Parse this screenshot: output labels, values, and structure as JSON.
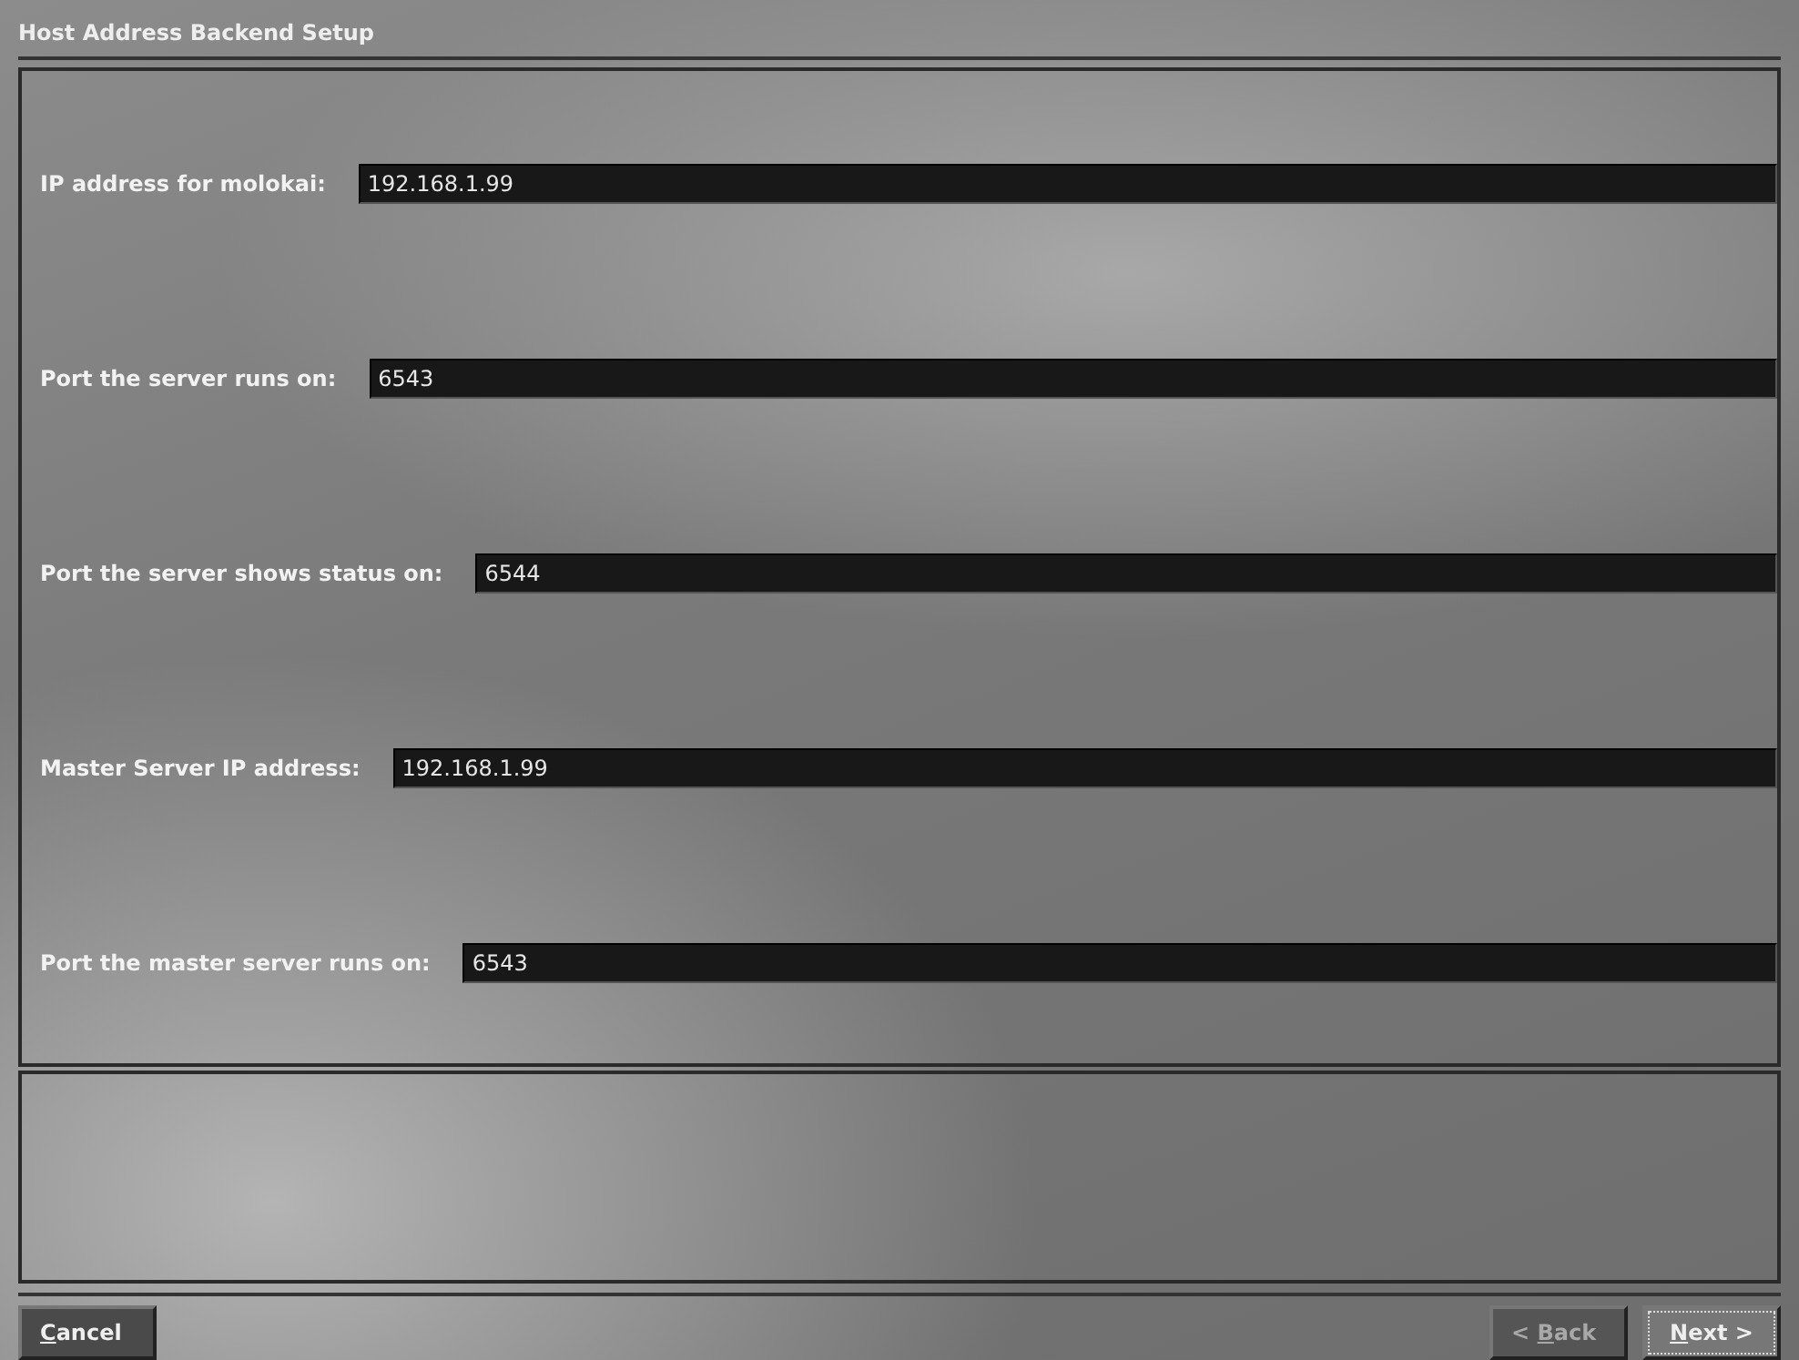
{
  "window": {
    "title": "Host Address Backend Setup"
  },
  "fields": [
    {
      "label": "IP address for molokai:",
      "value": "192.168.1.99"
    },
    {
      "label": "Port the server runs on:",
      "value": "6543"
    },
    {
      "label": "Port the server shows status on:",
      "value": "6544"
    },
    {
      "label": "Master Server IP address:",
      "value": "192.168.1.99"
    },
    {
      "label": "Port the master server runs on:",
      "value": "6543"
    }
  ],
  "buttons": [
    {
      "accesskey": "C",
      "after": "ancel",
      "disabled": false,
      "focused": false
    },
    {
      "before": "< ",
      "accesskey": "B",
      "after": "ack",
      "disabled": true,
      "focused": false
    },
    {
      "accesskey": "N",
      "after": "ext >",
      "disabled": false,
      "focused": true
    }
  ]
}
